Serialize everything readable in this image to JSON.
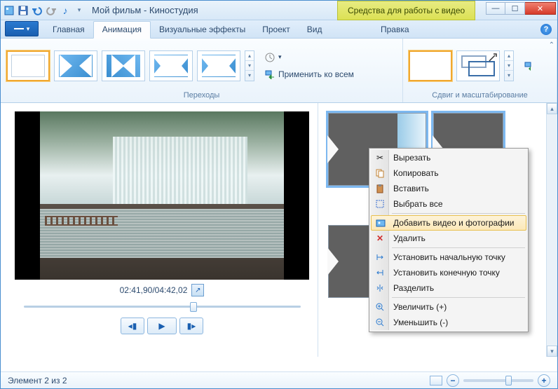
{
  "titlebar": {
    "title": "Мой фильм - Киностудия",
    "video_tools": "Средства для работы с видео"
  },
  "tabs": {
    "home": "Главная",
    "animation": "Анимация",
    "effects": "Визуальные эффекты",
    "project": "Проект",
    "view": "Вид",
    "edit": "Правка"
  },
  "ribbon": {
    "transitions_label": "Переходы",
    "apply_all": "Применить ко всем",
    "panzoom_label": "Сдвиг и масштабирование"
  },
  "preview": {
    "time": "02:41,90/04:42,02"
  },
  "context_menu": {
    "cut": "Вырезать",
    "copy": "Копировать",
    "paste": "Вставить",
    "select_all": "Выбрать все",
    "add_media": "Добавить видео и фотографии",
    "delete": "Удалить",
    "set_start": "Установить начальную точку",
    "set_end": "Установить конечную точку",
    "split": "Разделить",
    "zoom_in": "Увеличить (+)",
    "zoom_out": "Уменьшить (-)"
  },
  "statusbar": {
    "element": "Элемент 2 из 2"
  }
}
